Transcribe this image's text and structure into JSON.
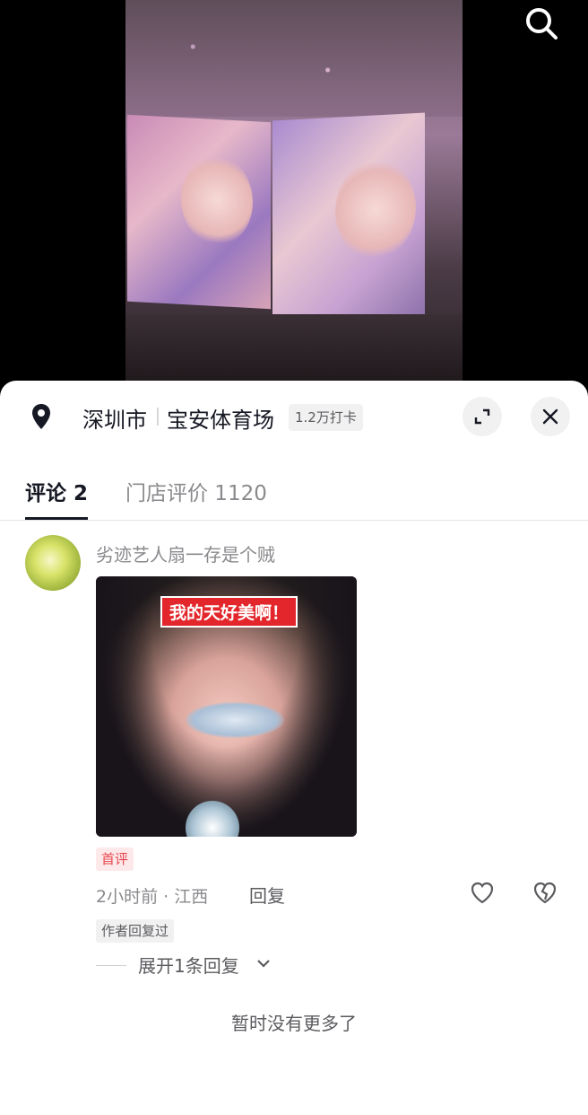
{
  "location": {
    "city": "深圳市",
    "venue": "宝安体育场",
    "checkins": "1.2万打卡"
  },
  "tabs": {
    "comments": "评论 2",
    "reviews": "门店评价 1120"
  },
  "comment": {
    "username": "劣迹艺人扇一存是个贼",
    "image_caption": "我的天好美啊！",
    "first_tag": "首评",
    "time_location": "2小时前 · 江西",
    "reply": "回复",
    "author_tag": "作者回复过",
    "expand_replies": "展开1条回复"
  },
  "footer": {
    "no_more": "暂时没有更多了"
  },
  "icons": {
    "search": "search-icon",
    "pin": "location-pin-icon",
    "expand": "expand-icon",
    "close": "close-icon",
    "like": "heart-icon",
    "dislike": "broken-heart-icon",
    "chevron": "chevron-down-icon"
  },
  "colors": {
    "accent_red": "#e3262b",
    "first_tag_text": "#e8474f",
    "text_primary": "#161823",
    "text_secondary": "#8a8a8e"
  }
}
